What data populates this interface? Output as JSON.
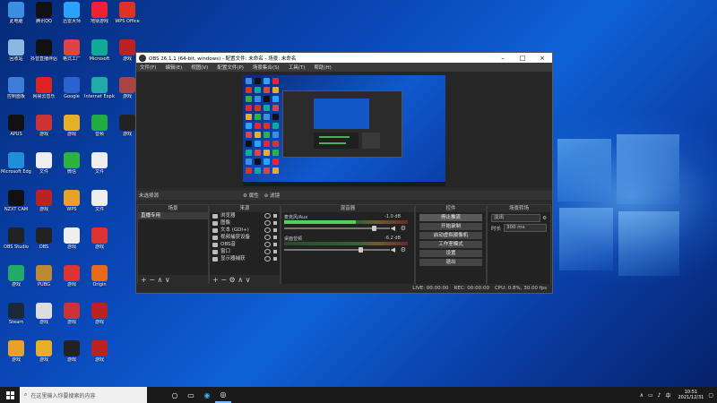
{
  "desktop": {
    "icons": [
      {
        "label": "此电脑",
        "color": "#3a8fe0"
      },
      {
        "label": "腾讯QQ",
        "color": "#111"
      },
      {
        "label": "迅雷大师",
        "color": "#2aa3ff"
      },
      {
        "label": "地狱游戏",
        "color": "#e23"
      },
      {
        "label": "WPS Office",
        "color": "#d32"
      },
      {
        "label": "回收站",
        "color": "#8bb8e0"
      },
      {
        "label": "抖音直播伴侣",
        "color": "#111"
      },
      {
        "label": "格式工厂",
        "color": "#d44"
      },
      {
        "label": "Microsoft",
        "color": "#1a9"
      },
      {
        "label": "游戏",
        "color": "#b22"
      },
      {
        "label": "控制面板",
        "color": "#3b7dd8"
      },
      {
        "label": "网易云音乐",
        "color": "#d22"
      },
      {
        "label": "Google",
        "color": "#2a62d0"
      },
      {
        "label": "Internet Explorer",
        "color": "#2aa"
      },
      {
        "label": "游戏",
        "color": "#a44"
      },
      {
        "label": "APUS",
        "color": "#111"
      },
      {
        "label": "游戏",
        "color": "#c33"
      },
      {
        "label": "游戏",
        "color": "#e5b028"
      },
      {
        "label": "音频",
        "color": "#2a4"
      },
      {
        "label": "游戏",
        "color": "#222"
      },
      {
        "label": "Microsoft Edge",
        "color": "#1e8fd8"
      },
      {
        "label": "文件",
        "color": "#eee"
      },
      {
        "label": "微信",
        "color": "#2bb33d"
      },
      {
        "label": "文件",
        "color": "#eee"
      },
      {
        "label": "NZXT CAM",
        "color": "#111"
      },
      {
        "label": "游戏",
        "color": "#b22"
      },
      {
        "label": "WPS",
        "color": "#e8a028"
      },
      {
        "label": "文件",
        "color": "#eee"
      },
      {
        "label": "OBS Studio",
        "color": "#222"
      },
      {
        "label": "OBS",
        "color": "#222"
      },
      {
        "label": "游戏",
        "color": "#eee"
      },
      {
        "label": "游戏",
        "color": "#d33"
      },
      {
        "label": "游戏",
        "color": "#2a6"
      },
      {
        "label": "PUBG",
        "color": "#b83"
      },
      {
        "label": "游戏",
        "color": "#d33"
      },
      {
        "label": "Origin",
        "color": "#e56a1a"
      },
      {
        "label": "Steam",
        "color": "#1b2838"
      },
      {
        "label": "游戏",
        "color": "#ddd"
      },
      {
        "label": "游戏",
        "color": "#c33"
      },
      {
        "label": "游戏",
        "color": "#b22"
      },
      {
        "label": "游戏",
        "color": "#e8a028"
      },
      {
        "label": "游戏",
        "color": "#e5b028"
      },
      {
        "label": "游戏",
        "color": "#222"
      },
      {
        "label": "游戏",
        "color": "#b22"
      }
    ]
  },
  "obs": {
    "title": "OBS 26.1.1 (64-bit, windows) - 配置文件: 未命名 - 场景: 未命名",
    "menu": [
      "文件(F)",
      "编辑(E)",
      "视图(V)",
      "配置文件(P)",
      "场景集合(S)",
      "工具(T)",
      "帮助(H)"
    ],
    "scene_label": "未选择源",
    "scene_btns": [
      "属性",
      "滤镜"
    ],
    "docks": {
      "scenes": {
        "title": "场景",
        "items": [
          "直播专用"
        ]
      },
      "sources": {
        "title": "来源",
        "items": [
          "浏览器",
          "图像",
          "文本 (GDI+)",
          "视频捕获设备",
          "OBS音",
          "窗口",
          "显示器捕获"
        ]
      },
      "mixer": {
        "title": "混音器",
        "channels": [
          {
            "name": "麦克风/Aux",
            "db": "-1.0 dB",
            "level": 0.58,
            "slider": 0.85
          },
          {
            "name": "桌面音频",
            "db": "-6.2 dB",
            "level": 0.0,
            "slider": 0.72
          }
        ]
      },
      "controls": {
        "title": "控件",
        "buttons": [
          "停止推流",
          "开始录制",
          "启动虚拟摄像机",
          "工作室模式",
          "设置",
          "退出"
        ]
      },
      "transitions": {
        "title": "场景转场",
        "type": "淡出",
        "duration_label": "时长",
        "duration": "300 ms"
      }
    },
    "status": {
      "live": "LIVE: 00:00:00",
      "rec": "REC: 00:00:00",
      "cpu": "CPU: 0.8%, 30.00 fps"
    }
  },
  "taskbar": {
    "search_placeholder": "在这里输入你要搜索的内容",
    "time": "10:51",
    "date": "2021/12/31",
    "tray_lang": "中"
  }
}
